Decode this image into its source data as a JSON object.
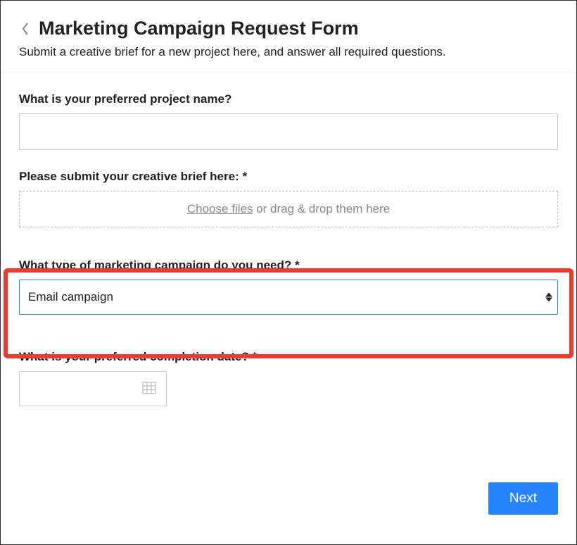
{
  "header": {
    "title": "Marketing Campaign Request Form",
    "subtitle": "Submit a creative brief for a new project here, and answer all required questions."
  },
  "fields": {
    "project_name": {
      "label": "What is your preferred project name?",
      "value": ""
    },
    "creative_brief": {
      "label": "Please submit your creative brief here: *",
      "choose_text": "Choose files",
      "drag_text": " or drag & drop them here"
    },
    "campaign_type": {
      "label": "What type of marketing campaign do you need? *",
      "selected": "Email campaign"
    },
    "completion_date": {
      "label": "What is your preferred completion date? *",
      "value": ""
    }
  },
  "footer": {
    "next_label": "Next"
  }
}
